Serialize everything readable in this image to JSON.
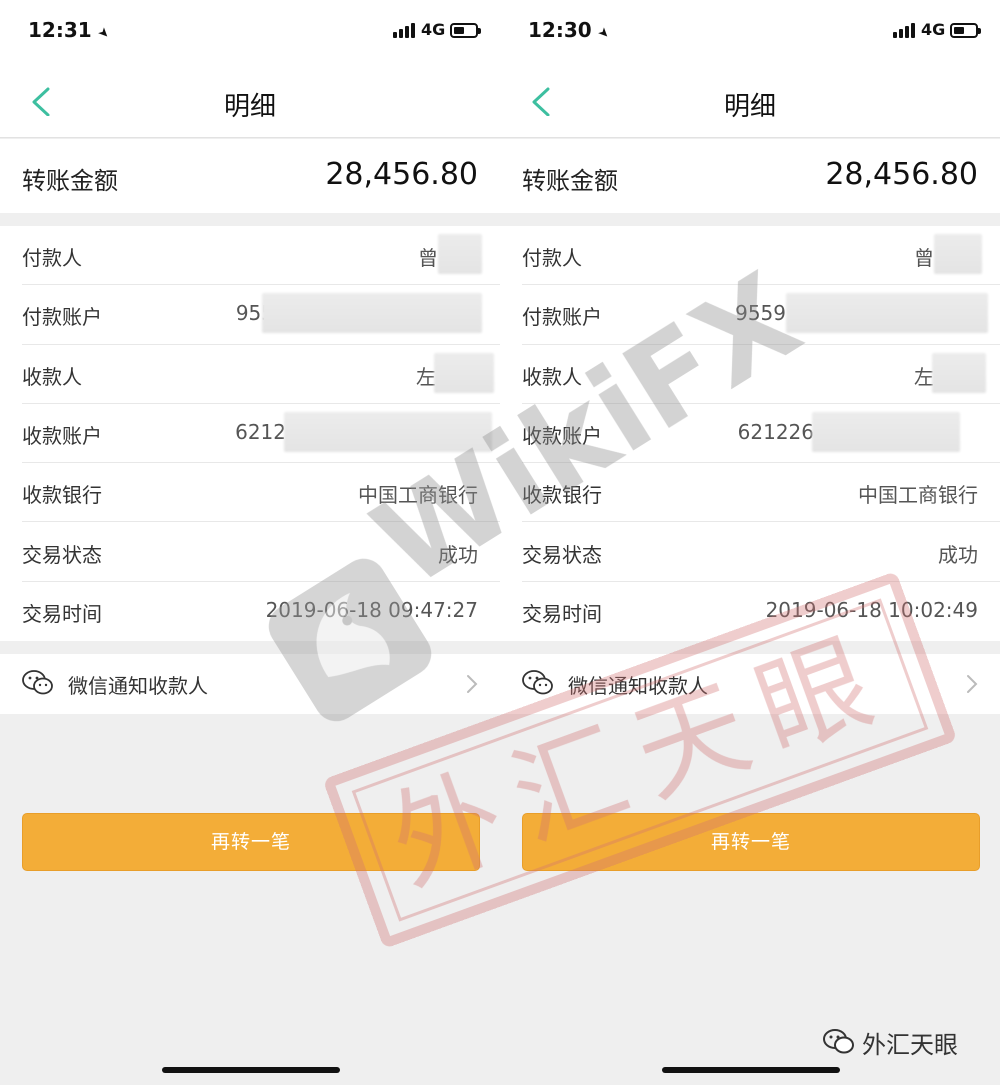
{
  "screens": [
    {
      "status": {
        "time": "12:31",
        "network": "4G"
      },
      "title": "明细",
      "amount_label": "转账金额",
      "amount": "28,456.80",
      "rows": [
        {
          "label": "付款人",
          "value": "曾"
        },
        {
          "label": "付款账户",
          "value": "955"
        },
        {
          "label": "收款人",
          "value": "左"
        },
        {
          "label": "收款账户",
          "value": "6212"
        },
        {
          "label": "收款银行",
          "value": "中国工商银行"
        },
        {
          "label": "交易状态",
          "value": "成功"
        },
        {
          "label": "交易时间",
          "value": "2019-06-18 09:47:27"
        }
      ],
      "wechat_label": "微信通知收款人",
      "button_label": "再转一笔"
    },
    {
      "status": {
        "time": "12:30",
        "network": "4G"
      },
      "title": "明细",
      "amount_label": "转账金额",
      "amount": "28,456.80",
      "rows": [
        {
          "label": "付款人",
          "value": "曾"
        },
        {
          "label": "付款账户",
          "value": "9559"
        },
        {
          "label": "收款人",
          "value": "左"
        },
        {
          "label": "收款账户",
          "value": "621226"
        },
        {
          "label": "收款银行",
          "value": "中国工商银行"
        },
        {
          "label": "交易状态",
          "value": "成功"
        },
        {
          "label": "交易时间",
          "value": "2019-06-18 10:02:49"
        }
      ],
      "wechat_label": "微信通知收款人",
      "button_label": "再转一笔"
    }
  ],
  "watermark": {
    "brand": "WikiFX",
    "seal_text": "外汇天眼"
  },
  "footer_brand": "外汇天眼",
  "colors": {
    "accent": "#3dbfa0",
    "button": "#f3ad38",
    "watermark": "#d9a3a3"
  }
}
